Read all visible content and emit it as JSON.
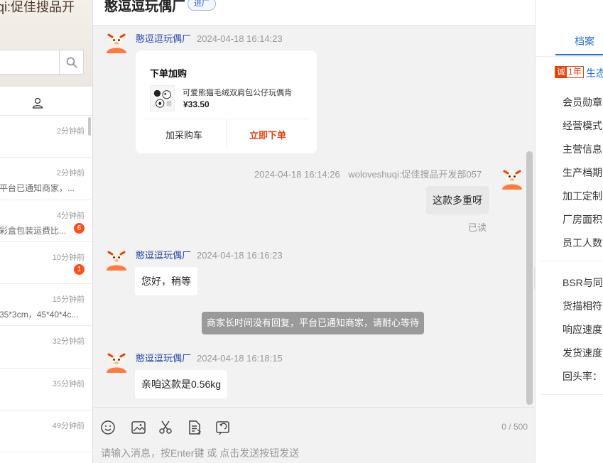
{
  "left_panel": {
    "header_title": "qi:促佳搜品开",
    "search": {
      "placeholder": ""
    },
    "sessions": [
      {
        "time": "2分钟前",
        "preview": "",
        "badge": ""
      },
      {
        "time": "2分钟前",
        "preview": "平台已通知商家，...",
        "badge": ""
      },
      {
        "time": "4分钟前",
        "preview": "彩盒包装运费比...",
        "badge": "6"
      },
      {
        "time": "10分钟前",
        "preview": "",
        "badge": "1"
      },
      {
        "time": "15分钟前",
        "preview": "35*3cm，45*40*4c...",
        "badge": ""
      },
      {
        "time": "32分钟前",
        "preview": "",
        "badge": ""
      },
      {
        "time": "35分钟前",
        "preview": "",
        "badge": ""
      },
      {
        "time": "49分钟前",
        "preview": "",
        "badge": ""
      }
    ]
  },
  "chat": {
    "shop_name": "憨逗逗玩偶厂",
    "shop_tag": "进厂",
    "messages": {
      "m1": {
        "sender": "憨逗逗玩偶厂",
        "datetime": "2024-04-18 16:14:23",
        "card": {
          "title": "下单加购",
          "product_name": "可爱熊猫毛绒双肩包公仔玩偶背",
          "price": "¥33.50",
          "btn_cart": "加采购车",
          "btn_order": "立即下单"
        }
      },
      "m2": {
        "datetime": "2024-04-18 16:14:26",
        "sender": "woloveshuqi:促佳搜品开发部057",
        "text": "这款多重呀",
        "status": "已读"
      },
      "m3": {
        "sender": "憨逗逗玩偶厂",
        "datetime": "2024-04-18 16:16:23",
        "text": "您好，稍等"
      },
      "system": "商家长时间没有回复，平台已通知商家，请耐心等待",
      "m4": {
        "sender": "憨逗逗玩偶厂",
        "datetime": "2024-04-18 16:18:15",
        "text": "亲咱这款是0.56kg"
      }
    },
    "composer": {
      "counter": "0 / 500",
      "placeholder": "请输入消息，按Enter键 或 点击发送按钮发送",
      "tools": [
        "smile-icon",
        "image-icon",
        "scissors-icon",
        "document-icon",
        "history-icon"
      ]
    }
  },
  "right_panel": {
    "tab": "档案",
    "cheng_badge_a": "诚",
    "cheng_badge_b": "1年",
    "section_title": "生态",
    "rows_a": [
      "会员勋章",
      "经营模式",
      "主营信息",
      "生产档期",
      "加工定制",
      "厂房面积",
      "员工人数"
    ],
    "rows_b": [
      "BSR与同",
      "货描相符",
      "响应速度",
      "发货速度",
      "回头率："
    ]
  },
  "colors": {
    "accent": "#1f6fd1",
    "orange": "#e8420b",
    "badge": "#ff4d1a"
  }
}
